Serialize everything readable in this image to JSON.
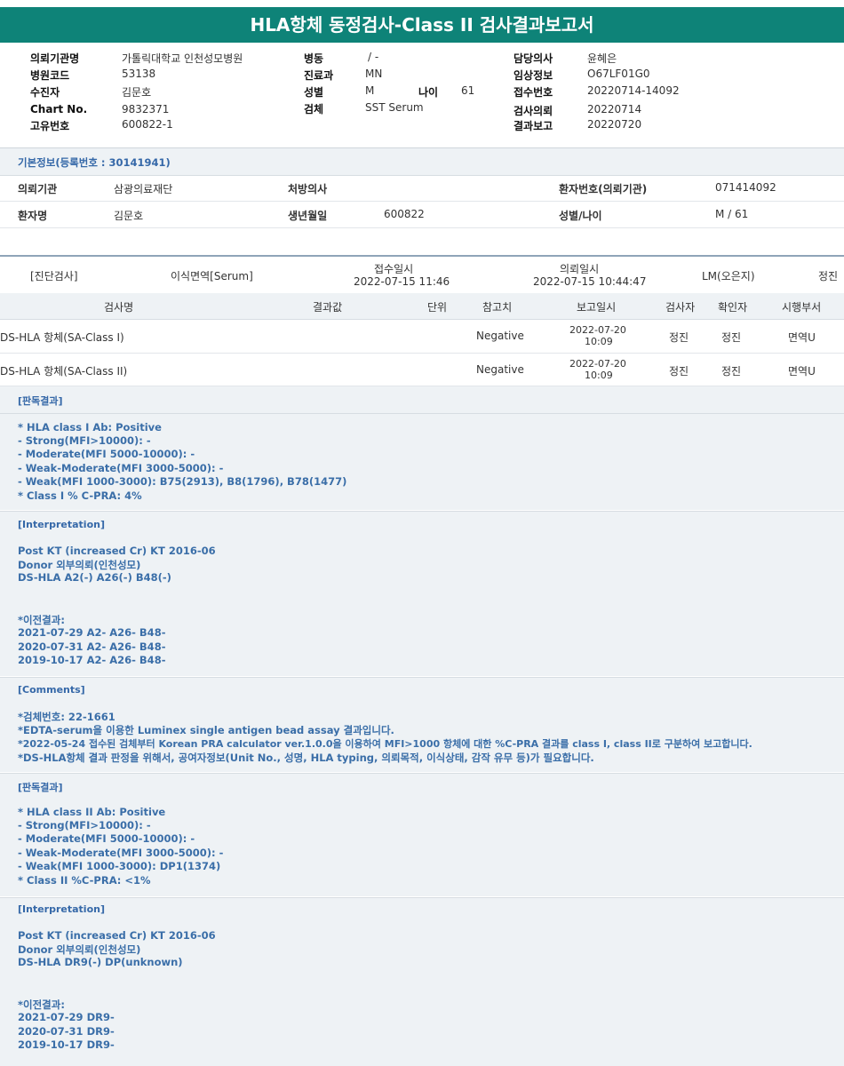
{
  "title": "HLA항체 동정검사-Class II 검사결과보고서",
  "header": {
    "col1": [
      {
        "label": "의뢰기관명",
        "value": "가톨릭대학교 인천성모병원"
      },
      {
        "label": "병원코드",
        "value": "53138"
      },
      {
        "label": "수진자",
        "value": "김문호"
      },
      {
        "label": "Chart No.",
        "value": "9832371"
      },
      {
        "label": "고유번호",
        "value": "600822-1"
      }
    ],
    "col2": [
      {
        "label": "병동",
        "value": "/ -"
      },
      {
        "label": "진료과",
        "value": "MN"
      },
      {
        "label": "성별",
        "value": "M"
      },
      {
        "label": "검체",
        "value": "SST Serum"
      }
    ],
    "age_label": "나이",
    "age_value": "61",
    "col3": [
      {
        "label": "담당의사",
        "value": "윤혜은"
      },
      {
        "label": "임상정보",
        "value": "O67LF01G0"
      },
      {
        "label": "접수번호",
        "value": "20220714-14092"
      },
      {
        "label": "검사의뢰",
        "value": "20220714"
      },
      {
        "label": "결과보고",
        "value": "20220720"
      }
    ]
  },
  "basic": {
    "title": "기본정보(등록번호 : 30141941)",
    "r1": {
      "l1": "의뢰기관",
      "v1": "삼광의료재단",
      "l2": "처방의사",
      "v2": "",
      "l3": "환자번호(의뢰기관)",
      "v3": "071414092"
    },
    "r2": {
      "l1": "환자명",
      "v1": "김문호",
      "l2": "생년월일",
      "v2": "600822",
      "l3": "성별/나이",
      "v3": "M / 61"
    }
  },
  "order": {
    "category": "[진단검사]",
    "specimen": "이식면역[Serum]",
    "recv_label": "접수일시",
    "recv_date": "2022-07-15 11:46",
    "req_label": "의뢰일시",
    "req_date": "2022-07-15 10:44:47",
    "doctor": "LM(오은지)",
    "tester": "정진"
  },
  "table": {
    "headers": [
      "검사명",
      "결과값",
      "단위",
      "참고치",
      "보고일시",
      "검사자",
      "확인자",
      "시행부서"
    ],
    "rows": [
      {
        "name": "DS-HLA 항체(SA-Class I)",
        "result": "",
        "unit": "",
        "ref": "Negative",
        "date": "2022-07-20",
        "time": "10:09",
        "tester": "정진",
        "checker": "정진",
        "dept": "면역U"
      },
      {
        "name": "DS-HLA 항체(SA-Class II)",
        "result": "",
        "unit": "",
        "ref": "Negative",
        "date": "2022-07-20",
        "time": "10:09",
        "tester": "정진",
        "checker": "정진",
        "dept": "면역U"
      }
    ]
  },
  "sections": [
    {
      "title": "[판독결과]",
      "lines": [
        "* HLA class I Ab: Positive",
        "- Strong(MFI>10000): -",
        "- Moderate(MFI 5000-10000): -",
        "- Weak-Moderate(MFI 3000-5000): -",
        "- Weak(MFI 1000-3000): B75(2913), B8(1796), B78(1477)",
        "* Class I % C-PRA: 4%"
      ]
    },
    {
      "title": "[Interpretation]",
      "lines": [
        "Post KT (increased Cr) KT 2016-06",
        "Donor 외부의뢰(인천성모)",
        "DS-HLA A2(-) A26(-) B48(-)",
        "",
        "",
        "*이전결과:",
        "2021-07-29 A2- A26- B48-",
        "2020-07-31 A2- A26- B48-",
        "2019-10-17 A2- A26- B48-"
      ]
    },
    {
      "title": "[Comments]",
      "lines": [
        "*검체번호: 22-1661",
        "*EDTA-serum을 이용한 Luminex single antigen bead assay 결과입니다.",
        "*2022-05-24 접수된 검체부터 Korean PRA calculator ver.1.0.0을 이용하여 MFI>1000 항체에 대한 %C-PRA 결과를 class I, class II로 구분하여 보고합니다.",
        "*DS-HLA항체 결과 판정을 위해서, 공여자정보(Unit No., 성명, HLA typing, 의뢰목적, 이식상태, 감작 유무 등)가 필요합니다."
      ]
    },
    {
      "title": "[판독결과]",
      "lines": [
        "* HLA class II Ab: Positive",
        "- Strong(MFI>10000): -",
        "- Moderate(MFI 5000-10000): -",
        "- Weak-Moderate(MFI 3000-5000): -",
        "- Weak(MFI 1000-3000): DP1(1374)",
        "* Class II %C-PRA: <1%"
      ]
    },
    {
      "title": "[Interpretation]",
      "lines": [
        "Post KT (increased Cr) KT 2016-06",
        "Donor 외부의뢰(인천성모)",
        "DS-HLA DR9(-) DP(unknown)",
        "",
        "",
        "*이전결과:",
        "2021-07-29 DR9-",
        "2020-07-31 DR9-",
        "2019-10-17 DR9-"
      ]
    }
  ]
}
